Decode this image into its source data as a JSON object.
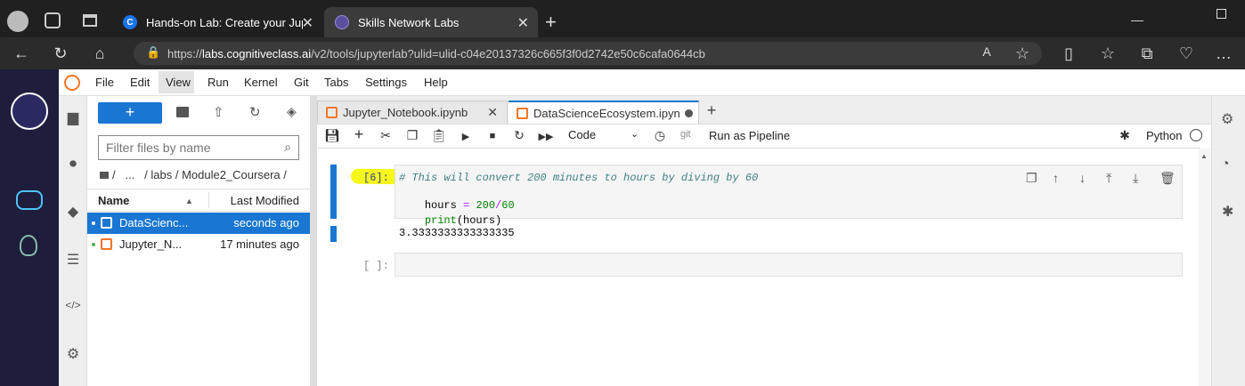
{
  "browser": {
    "tabs": [
      {
        "title": "Hands-on Lab: Create your Jupyt",
        "favicon": "C",
        "active": false
      },
      {
        "title": "Skills Network Labs",
        "active": true
      }
    ],
    "url_prefix": "https://",
    "url_host": "labs.cognitiveclass.ai",
    "url_path": "/v2/tools/jupyterlab?ulid=ulid-c04e20137326c665f3f0d2742e50c6cafa0644cb"
  },
  "menu": [
    "File",
    "Edit",
    "View",
    "Run",
    "Kernel",
    "Git",
    "Tabs",
    "Settings",
    "Help"
  ],
  "filebrowser": {
    "new_button": "+",
    "filter_placeholder": "Filter files by name",
    "breadcrumb": [
      "/",
      "...",
      "/ labs / Module2_Coursera /"
    ],
    "columns": {
      "name": "Name",
      "modified": "Last Modified"
    },
    "files": [
      {
        "name": "DataScienc...",
        "modified": "seconds ago",
        "selected": true
      },
      {
        "name": "Jupyter_N...",
        "modified": "17 minutes ago",
        "selected": false
      }
    ]
  },
  "notebook_tabs": [
    {
      "title": "Jupyter_Notebook.ipynb",
      "active": false
    },
    {
      "title": "DataScienceEcosystem.ipyn",
      "active": true
    }
  ],
  "toolbar": {
    "cell_type": "Code",
    "git_label": "git",
    "pipeline_label": "Run as Pipeline",
    "kernel": "Python"
  },
  "cells": [
    {
      "prompt": "[6]:",
      "lines": [
        {
          "type": "comment",
          "text": "# This will convert 200 minutes to hours by diving by 60"
        },
        {
          "type": "code",
          "parts": [
            "hours",
            " = ",
            "200",
            "/",
            "60"
          ]
        },
        {
          "type": "code2",
          "parts": [
            "print",
            "(hours)"
          ]
        }
      ],
      "output": "3.3333333333333335"
    },
    {
      "prompt": "[ ]:"
    }
  ],
  "colors": {
    "accent": "#1976d2",
    "highlight": "#f4f700",
    "orange": "#f37626",
    "dark_sidebar": "#1e1d3c"
  }
}
